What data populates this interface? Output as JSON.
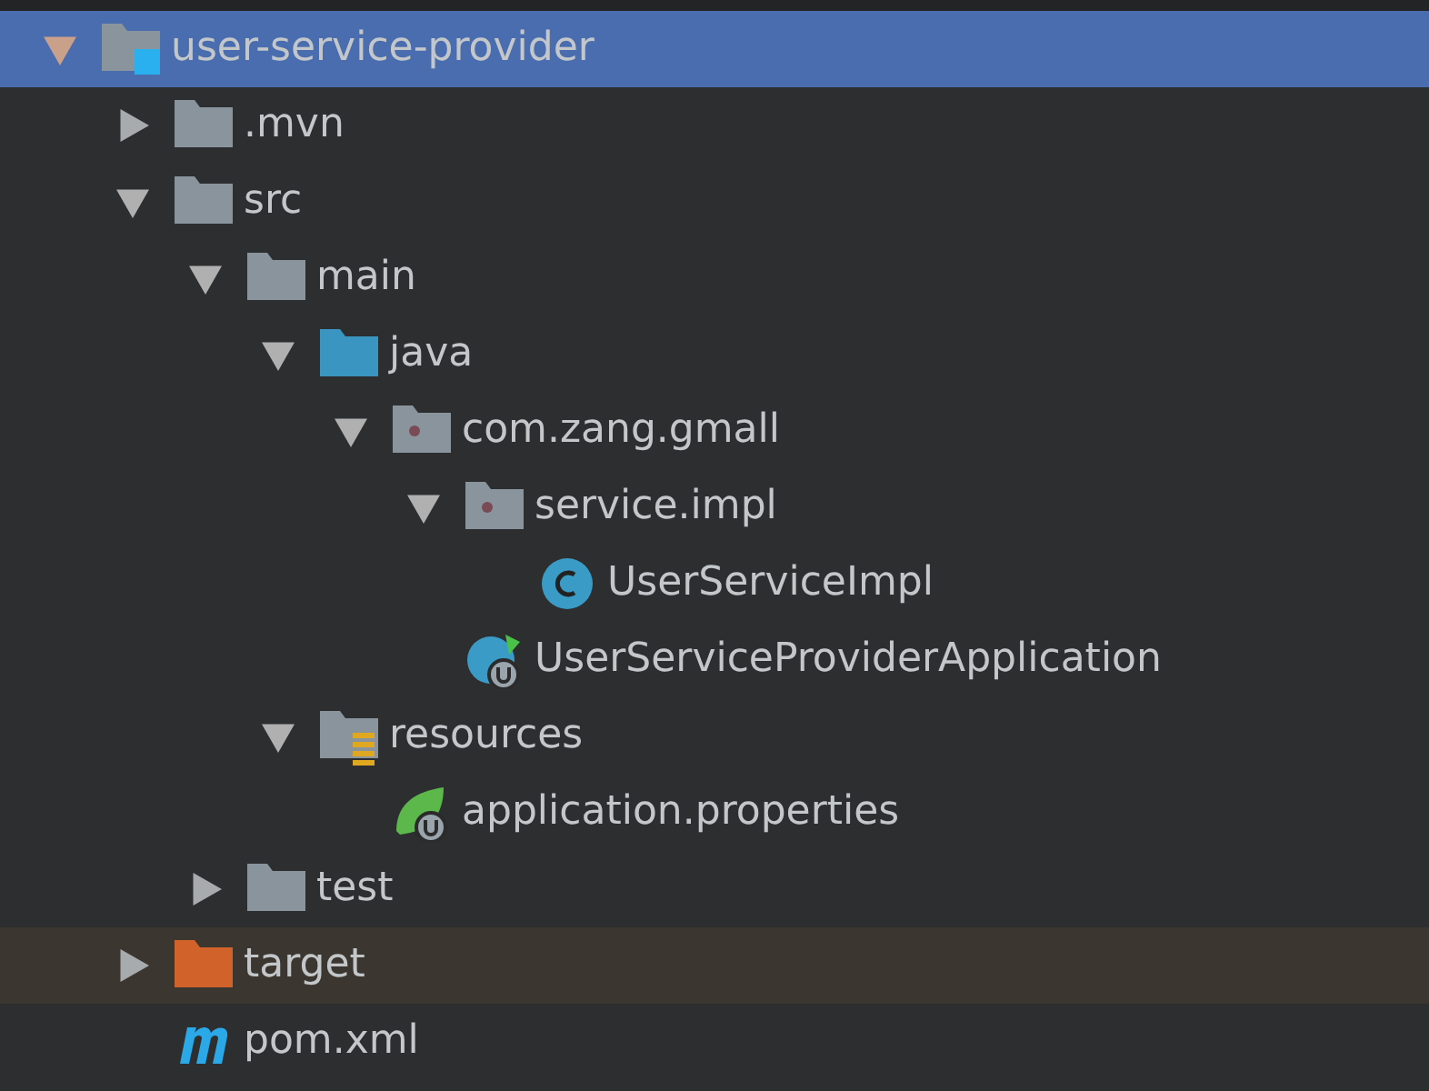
{
  "tree": [
    {
      "label": "user-service-provider",
      "kind": "module",
      "expanded": true,
      "selected": true,
      "highlighted": false,
      "children": [
        {
          "label": ".mvn",
          "kind": "folder",
          "expanded": false,
          "selected": false,
          "highlighted": false
        },
        {
          "label": "src",
          "kind": "folder",
          "expanded": true,
          "selected": false,
          "highlighted": false,
          "children": [
            {
              "label": "main",
              "kind": "folder",
              "expanded": true,
              "selected": false,
              "highlighted": false,
              "children": [
                {
                  "label": "java",
                  "kind": "source-folder",
                  "expanded": true,
                  "selected": false,
                  "highlighted": false,
                  "children": [
                    {
                      "label": "com.zang.gmall",
                      "kind": "package",
                      "expanded": true,
                      "selected": false,
                      "highlighted": false,
                      "children": [
                        {
                          "label": "service.impl",
                          "kind": "package",
                          "expanded": true,
                          "selected": false,
                          "highlighted": false,
                          "children": [
                            {
                              "label": "UserServiceImpl",
                              "kind": "class",
                              "selected": false,
                              "highlighted": false
                            }
                          ]
                        },
                        {
                          "label": "UserServiceProviderApplication",
                          "kind": "boot-class",
                          "selected": false,
                          "highlighted": false
                        }
                      ]
                    }
                  ]
                },
                {
                  "label": "resources",
                  "kind": "resources",
                  "expanded": true,
                  "selected": false,
                  "highlighted": false,
                  "children": [
                    {
                      "label": "application.properties",
                      "kind": "properties",
                      "selected": false,
                      "highlighted": false
                    }
                  ]
                }
              ]
            },
            {
              "label": "test",
              "kind": "folder",
              "expanded": false,
              "selected": false,
              "highlighted": false
            }
          ]
        },
        {
          "label": "target",
          "kind": "excluded-folder",
          "expanded": false,
          "selected": false,
          "highlighted": true
        },
        {
          "label": "pom.xml",
          "kind": "maven",
          "selected": false,
          "highlighted": false
        }
      ]
    }
  ]
}
